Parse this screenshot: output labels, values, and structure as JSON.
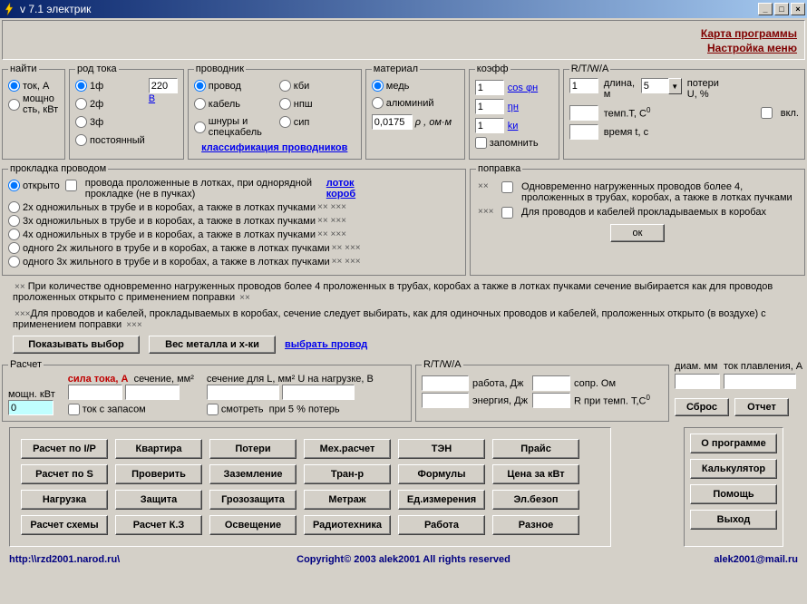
{
  "window": {
    "title": "v 7.1 электрик",
    "links": {
      "map": "Карта программы",
      "menu": "Настройка меню"
    }
  },
  "find": {
    "legend": "найти",
    "opt_current": "ток, А",
    "opt_power": "мощно сть, кВт"
  },
  "current_type": {
    "legend": "род тока",
    "phase1": "1ф",
    "phase2": "2ф",
    "phase3": "3ф",
    "dc": "постоянный",
    "voltage_value": "220",
    "voltage_link": "В"
  },
  "conductor": {
    "legend": "проводник",
    "wire": "провод",
    "cable": "кабель",
    "cord": "шнуры и спецкабель",
    "kbi": "кби",
    "npsh": "нпш",
    "sip": "сип",
    "class_link": "классификация проводников"
  },
  "material": {
    "legend": "материал",
    "copper": "медь",
    "aluminium": "алюминий",
    "rho_value": "0,0175",
    "rho_label": "ρ  , ом·м"
  },
  "coeff": {
    "legend": "коэфф",
    "v1": "1",
    "v2": "1",
    "v3": "1",
    "l1": "cos φн",
    "l2": "ηн",
    "l3": "kи",
    "remember": "запомнить"
  },
  "rtwa1": {
    "legend": "R/T/W/A",
    "len_val": "1",
    "len_label": "длина, м",
    "combo_val": "5",
    "loss_label": "потери U, %",
    "temp_label": "темп.Т, С",
    "incl": "вкл.",
    "time_label": "время t, c"
  },
  "laying": {
    "legend": "прокладка проводом",
    "open": "открыто",
    "open_note": "провода проложенные в лотках, при однорядной прокладке (не в пучках)",
    "link1": "лоток",
    "link2": "короб",
    "r1": "2x одножильных в трубе и в коробах, а также в лотках пучками",
    "r2": "3x одножильных в трубе и в коробах, а также в лотках пучками",
    "r3": "4x одножильных в трубе и в коробах, а также в лотках пучками",
    "r4": "одного 2x жильного в трубе и в коробах, а также в лотках пучками",
    "r5": "одного 3x жильного в трубе и в коробах, а также в лотках пучками",
    "note1": "При количестве одновременно нагруженных проводов более 4 проложенных в трубах, коробах а также в лотках пучками сечение выбирается как для проводов проложенных открыто с применением поправки",
    "note2": "Для проводов и кабелей, прокладываемых в коробах, сечение следует выбирать, как для одиночных проводов и кабелей, проложенных открыто (в воздухе) с применением поправки",
    "btn_show": "Показывать выбор",
    "btn_weight": "Вес металла и х-ки",
    "link_choose": "выбрать провод"
  },
  "correction": {
    "legend": "поправка",
    "c1": "Одновременно нагруженных проводов более 4, проложенных в трубах, коробах, а также в лотках пучками",
    "c2": "Для проводов и кабелей прокладываемых в коробах",
    "ok": "ок"
  },
  "calc": {
    "legend": "Расчет",
    "power_label": "мощн. кВт",
    "power_val": "0",
    "current_label": "сила тока, А",
    "section_label": "сечение, мм²",
    "reserve": "ток с запасом",
    "sectionL_label": "сечение для L, мм² U на нагрузке, В",
    "look": "смотреть",
    "loss5": "при 5 % потерь"
  },
  "rtwa2": {
    "legend": "R/T/W/A",
    "work": "работа, Дж",
    "res": "сопр. Ом",
    "energy": "энергия, Дж",
    "rtemp": "R при темп. T,С"
  },
  "out": {
    "diam": "диам. мм",
    "melt": "ток плавления, А",
    "reset": "Сброс",
    "report": "Отчет"
  },
  "buttons": {
    "r1c1": "Расчет по I/P",
    "r1c2": "Квартира",
    "r1c3": "Потери",
    "r1c4": "Мех.расчет",
    "r1c5": "ТЭН",
    "r1c6": "Прайс",
    "r2c1": "Расчет по S",
    "r2c2": "Проверить",
    "r2c3": "Заземление",
    "r2c4": "Тран-р",
    "r2c5": "Формулы",
    "r2c6": "Цена за кВт",
    "r3c1": "Нагрузка",
    "r3c2": "Защита",
    "r3c3": "Грозозащита",
    "r3c4": "Метраж",
    "r3c5": "Ед.измерения",
    "r3c6": "Эл.безоп",
    "r4c1": "Расчет схемы",
    "r4c2": "Расчет К.З",
    "r4c3": "Освещение",
    "r4c4": "Радиотехника",
    "r4c5": "Работа",
    "r4c6": "Разное",
    "about": "О программе",
    "calc": "Калькулятор",
    "help": "Помощь",
    "exit": "Выход"
  },
  "footer": {
    "left": "http:\\\\rzd2001.narod.ru\\",
    "center": "Copyright© 2003 alek2001 All rights reserved",
    "right": "alek2001@mail.ru"
  }
}
